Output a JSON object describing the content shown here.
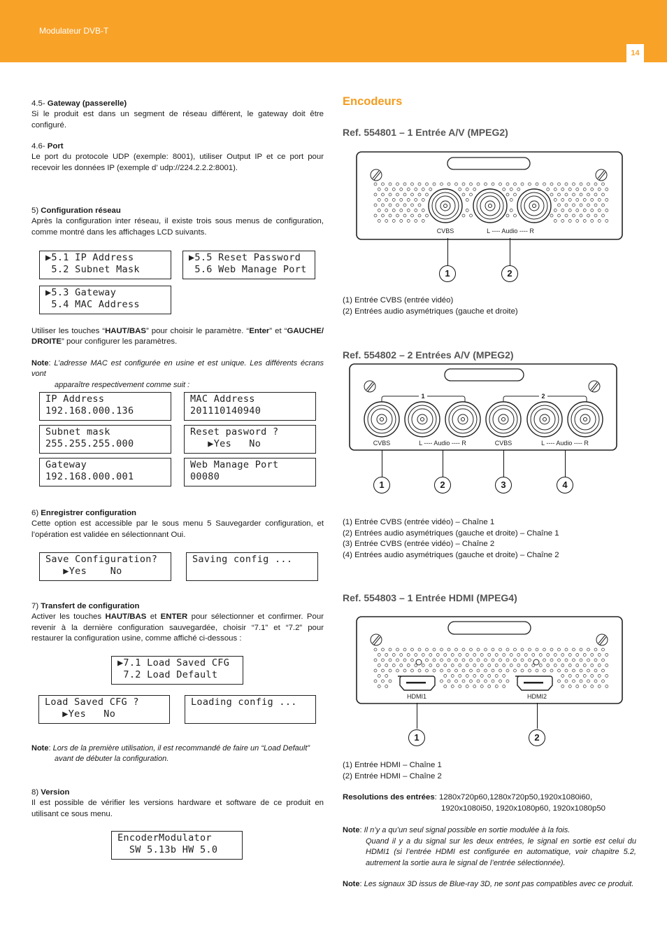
{
  "header": {
    "title": "Modulateur DVB-T",
    "page_number": "14"
  },
  "left": {
    "s45": {
      "num": "4.5- ",
      "title": "Gateway (passerelle)",
      "body": "Si le produit est dans un segment de réseau différent, le gateway doit être configuré."
    },
    "s46": {
      "num": "4.6- ",
      "title": "Port",
      "body": "Le port du protocole UDP (exemple: 8001), utiliser Output IP et ce port pour recevoir les données IP (exemple d’ udp://224.2.2.2:8001)."
    },
    "s5": {
      "num": "5) ",
      "title": "Configuration réseau",
      "body": "Après la configuration inter réseau, il existe trois sous menus de configuration, comme montré dans les affichages LCD suivants."
    },
    "lcd_menu": [
      {
        "line1": "▶5.1 IP Address",
        "line2": " 5.2 Subnet Mask"
      },
      {
        "line1": "▶5.5 Reset Password",
        "line2": " 5.6 Web Manage Port"
      },
      {
        "line1": "▶5.3 Gateway",
        "line2": " 5.4 MAC Address"
      }
    ],
    "keys_text": {
      "p1": "Utiliser les touches “",
      "k1": "HAUT/BAS",
      "p2": "” pour choisir le paramètre. “",
      "k2": "Enter",
      "p3": "” et “",
      "k3": "GAUCHE/ DROITE",
      "p4": "” pour configurer les paramètres."
    },
    "note1": {
      "label": "Note",
      "text1": "L’adresse MAC est configurée en usine et est unique. Les différents écrans vont",
      "text2": "apparaître respectivement comme suit :"
    },
    "lcd_values": [
      {
        "line1": "IP Address",
        "line2": "192.168.000.136"
      },
      {
        "line1": "MAC Address",
        "line2": "201110140940"
      },
      {
        "line1": "Subnet mask",
        "line2": "255.255.255.000"
      },
      {
        "line1": "Reset pasword ?",
        "line2": "   ▶Yes   No"
      },
      {
        "line1": "Gateway",
        "line2": "192.168.000.001"
      },
      {
        "line1": "Web Manage Port",
        "line2": "00080"
      }
    ],
    "s6": {
      "num": "6) ",
      "title": "Enregistrer configuration",
      "body": "Cette option est accessible par le sous menu 5 Sauvegarder configuration, et l’opération est validée en sélectionnant Oui."
    },
    "lcd_save": [
      {
        "line1": "Save Configuration?",
        "line2": "   ▶Yes    No"
      },
      {
        "line1": "Saving config ...",
        "line2": ""
      }
    ],
    "s7": {
      "num": "7) ",
      "title": "Transfert de configuration",
      "p1": "Activer les touches ",
      "k1": "HAUT/BAS",
      "p2": " et ",
      "k2": "ENTER",
      "p3": " pour sélectionner et confirmer. Pour revenir à la dernière configuration sauvegardée, choisir  “7.1” et “7.2” pour restaurer la configuration usine, comme affiché ci-dessous :"
    },
    "lcd_load": [
      {
        "line1": "▶7.1 Load Saved CFG",
        "line2": " 7.2 Load Default"
      },
      {
        "line1": "Load Saved CFG ?",
        "line2": "   ▶Yes   No"
      },
      {
        "line1": "Loading config ...",
        "line2": ""
      }
    ],
    "note2": {
      "label": "Note",
      "text1": "Lors de la première utilisation, il est recommandé de faire un “Load Default”",
      "text2": "avant de débuter la configuration."
    },
    "s8": {
      "num": "8) ",
      "title": "Version",
      "body": "Il est possible de vérifier les versions hardware et software de ce produit en utilisant ce sous menu."
    },
    "lcd_version": {
      "line1": "EncoderModulator",
      "line2": "  SW 5.13b HW 5.0"
    }
  },
  "right": {
    "heading": "Encodeurs",
    "ref1": {
      "title": "Ref. 554801 – 1 Entrée A/V (MPEG2)",
      "labels": {
        "cvbs": "CVBS",
        "audio": "L ---- Audio ---- R"
      },
      "callouts": [
        "1",
        "2"
      ],
      "items": [
        "(1) Entrée CVBS (entrée vidéo)",
        "(2) Entrées audio asymétriques (gauche et droite)"
      ]
    },
    "ref2": {
      "title": "Ref. 554802 – 2 Entrées A/V (MPEG2)",
      "groups": [
        "1",
        "2"
      ],
      "labels": {
        "cvbs": "CVBS",
        "audio": "L ---- Audio ---- R"
      },
      "callouts": [
        "1",
        "2",
        "3",
        "4"
      ],
      "items": [
        "(1) Entrée CVBS (entrée vidéo) – Chaîne 1",
        "(2) Entrées audio asymétriques (gauche et droite) – Chaîne 1",
        "(3) Entrée CVBS (entrée vidéo) – Chaîne 2",
        "(4) Entrées audio asymétriques (gauche et droite) – Chaîne 2"
      ]
    },
    "ref3": {
      "title": "Ref. 554803 – 1 Entrée HDMI (MPEG4)",
      "labels": {
        "hdmi1": "HDMI1",
        "hdmi2": "HDMI2"
      },
      "callouts": [
        "1",
        "2"
      ],
      "items": [
        "(1) Entrée HDMI – Chaîne 1",
        "(2) Entrée HDMI – Chaîne 2"
      ],
      "res_label": "Resolutions des entrées",
      "res_line1": ": 1280x720p60,1280x720p50,1920x1080i60,",
      "res_line2": "1920x1080i50, 1920x1080p60, 1920x1080p50"
    },
    "note3": {
      "label": "Note",
      "line1": "Il n’y a qu’un seul signal possible en sortie modulée à la fois.",
      "line2": "Quand il y a du signal sur les deux entrées, le signal en sortie est celui du HDMI1 (si l’entrée HDMI est configurée en automatique, voir chapitre 5.2, autrement la sortie aura le signal de l’entrée sélectionnée)."
    },
    "note4": {
      "label": "Note",
      "text": "Les signaux 3D issus de Blue-ray 3D, ne sont pas compatibles avec ce produit."
    }
  }
}
